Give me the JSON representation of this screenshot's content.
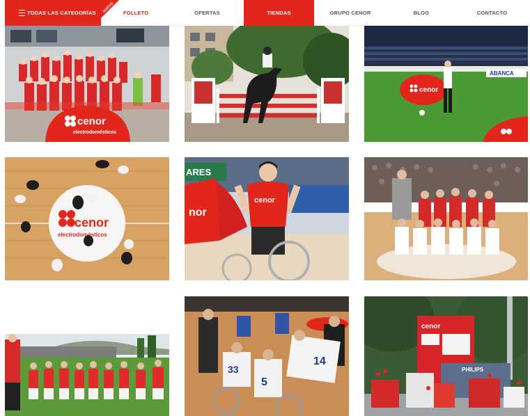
{
  "nav": {
    "categories_label": "TODAS LAS CATEGORÍAS",
    "nuevo_badge": "NUEVO",
    "folleto": "FOLLETO",
    "ofertas": "OFERTAS",
    "tiendas": "TIENDAS",
    "grupo": "GRUPO CENOR",
    "blog": "BLOG",
    "contacto": "CONTACTO"
  },
  "tiles": {
    "t1": {
      "brand": "cenor",
      "sub": "electrodomésticos"
    },
    "t3": {
      "brand": "cenor",
      "banner": "ABANCA"
    },
    "t4": {
      "brand": "cenor",
      "sub": "electrodomésticos"
    },
    "t5": {
      "banner": "ARES",
      "brand": "cenor",
      "banner2": "nor"
    },
    "t8": {
      "jersey_numbers": [
        "14",
        "33",
        "5"
      ]
    },
    "t9": {
      "brand": "cenor",
      "banner": "PHILIPS"
    }
  },
  "colors": {
    "brand_red": "#e2261c",
    "nav_text": "#555555"
  },
  "icons": {
    "menu": "hamburger-icon"
  }
}
